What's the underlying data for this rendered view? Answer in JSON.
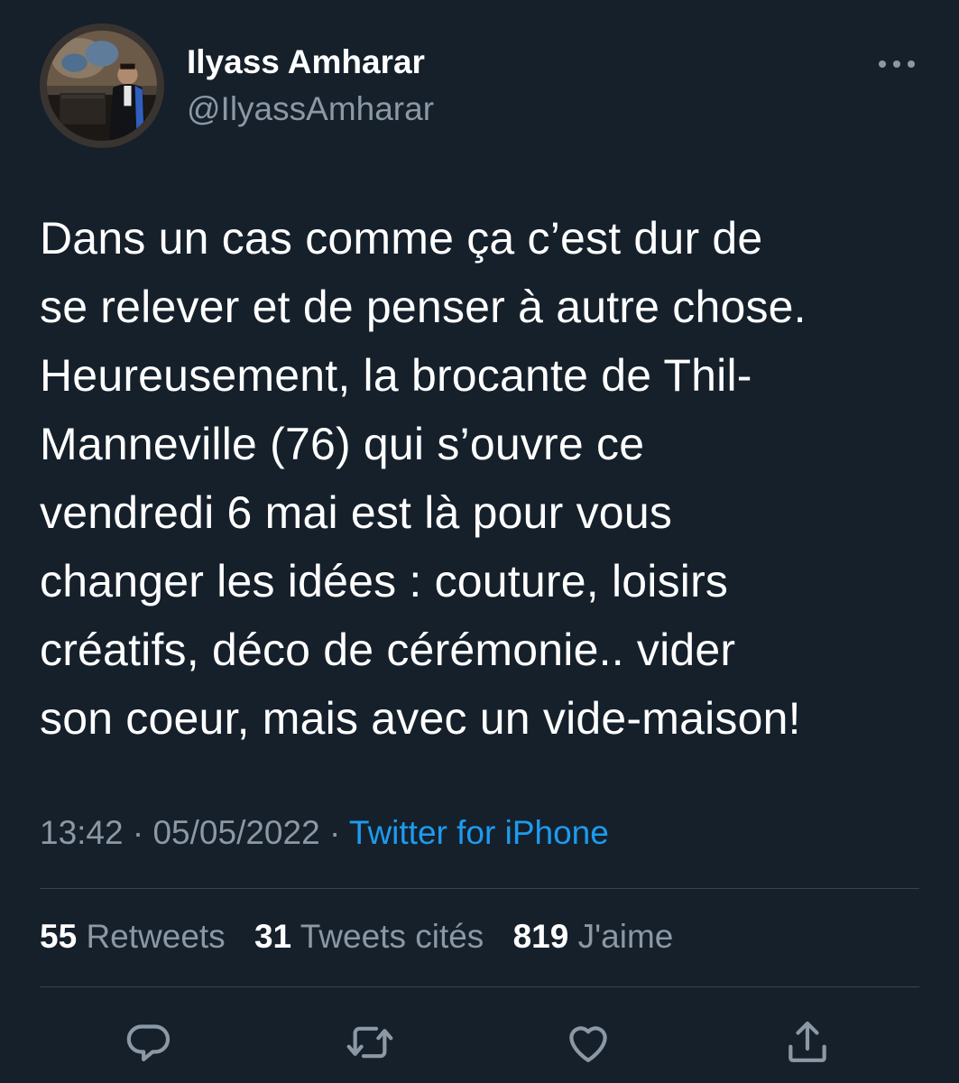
{
  "author": {
    "display_name": "Ilyass Amharar",
    "handle": "@IlyassAmharar"
  },
  "tweet": {
    "text": "Dans un cas comme ça c’est dur de\nse relever et de penser à autre chose.\nHeureusement, la brocante de Thil-\nManneville (76) qui s’ouvre ce\nvendredi 6 mai est là pour vous\nchanger les idées : couture, loisirs\ncréatifs, déco de cérémonie.. vider\nson coeur, mais avec un vide-maison!"
  },
  "meta": {
    "time": "13:42",
    "separator": "·",
    "date": "05/05/2022",
    "source": "Twitter for iPhone"
  },
  "stats": {
    "retweets_count": "55",
    "retweets_label": "Retweets",
    "quotes_count": "31",
    "quotes_label": "Tweets cités",
    "likes_count": "819",
    "likes_label": "J'aime"
  },
  "actions": {
    "reply_icon": "reply-icon",
    "retweet_icon": "retweet-icon",
    "like_icon": "like-icon",
    "share_icon": "share-icon",
    "more_icon": "more-icon"
  },
  "colors": {
    "background": "#15202b",
    "text_primary": "#ffffff",
    "text_secondary": "#8b98a5",
    "accent": "#1d9bf0",
    "divider": "#38444d"
  }
}
